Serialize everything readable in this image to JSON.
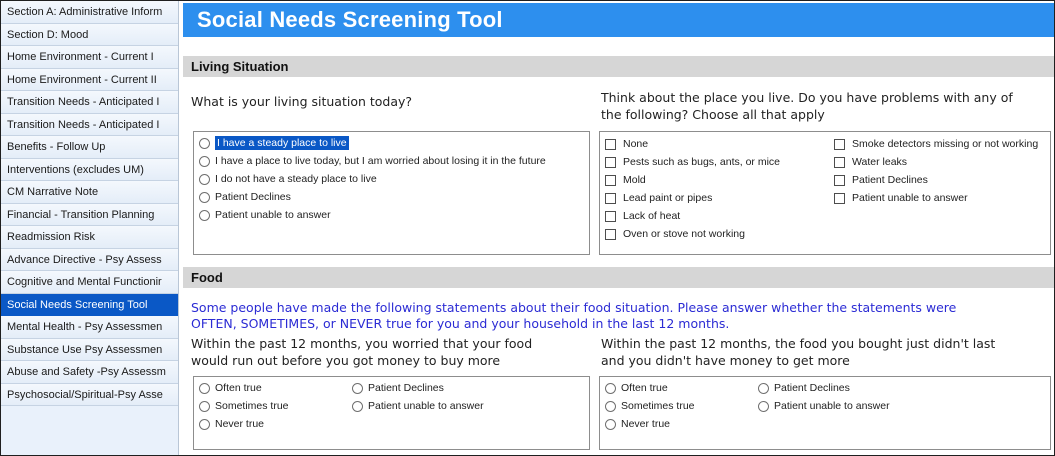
{
  "sidebar": {
    "items": [
      {
        "label": "Section A: Administrative Inform"
      },
      {
        "label": "Section D: Mood"
      },
      {
        "label": "Home Environment - Current I"
      },
      {
        "label": "Home Environment - Current II"
      },
      {
        "label": "Transition Needs - Anticipated I"
      },
      {
        "label": "Transition Needs - Anticipated I"
      },
      {
        "label": "Benefits - Follow Up"
      },
      {
        "label": "Interventions (excludes UM)"
      },
      {
        "label": "CM Narrative Note"
      },
      {
        "label": "Financial - Transition Planning"
      },
      {
        "label": "Readmission Risk"
      },
      {
        "label": "Advance Directive - Psy Assess"
      },
      {
        "label": "Cognitive and Mental Functionir"
      },
      {
        "label": "Social Needs Screening Tool"
      },
      {
        "label": "Mental Health - Psy Assessmen"
      },
      {
        "label": "Substance Use Psy Assessmen"
      },
      {
        "label": "Abuse and Safety -Psy Assessm"
      },
      {
        "label": "Psychosocial/Spiritual-Psy Asse"
      }
    ],
    "active_index": 13
  },
  "main": {
    "title": "Social Needs Screening Tool",
    "living": {
      "header": "Living Situation",
      "q1": {
        "text": "What is your living situation today?",
        "options": [
          "I have a steady place to live",
          "I have a place to live today, but I am worried about losing it in the future",
          "I do not have a steady place to live",
          "Patient Declines",
          "Patient unable to answer"
        ]
      },
      "q2": {
        "text_line1": "Think about the place you live. Do you have problems with any of",
        "text_line2": "the following? Choose all that apply",
        "col1": [
          "None",
          "Pests such as bugs, ants, or mice",
          "Mold",
          "Lead paint or pipes",
          "Lack of heat",
          "Oven or stove not working"
        ],
        "col2": [
          "Smoke detectors missing or not working",
          "Water leaks",
          "Patient Declines",
          "Patient unable to answer"
        ]
      }
    },
    "food": {
      "header": "Food",
      "intro_line1": "Some people have made the following statements about their food situation. Please answer whether the statements were",
      "intro_line2": "OFTEN, SOMETIMES, or NEVER true for you and your household in the last 12 months.",
      "q1": {
        "line1": "Within the past 12 months, you worried that your food",
        "line2": "would run out before you got money to buy more",
        "col1": [
          "Often true",
          "Sometimes true",
          "Never true"
        ],
        "col2": [
          "Patient Declines",
          "Patient unable to answer"
        ]
      },
      "q2": {
        "line1": "Within the past 12 months, the food you bought just didn't last",
        "line2": "and you didn't have money to get more",
        "col1": [
          "Often true",
          "Sometimes true",
          "Never true"
        ],
        "col2": [
          "Patient Declines",
          "Patient unable to answer"
        ]
      }
    }
  },
  "colors": {
    "title_bar": "#2d8fee",
    "active_sidebar": "#0a58c6",
    "section_header": "#d6d6d6",
    "intro_text": "#2b2bd4"
  }
}
